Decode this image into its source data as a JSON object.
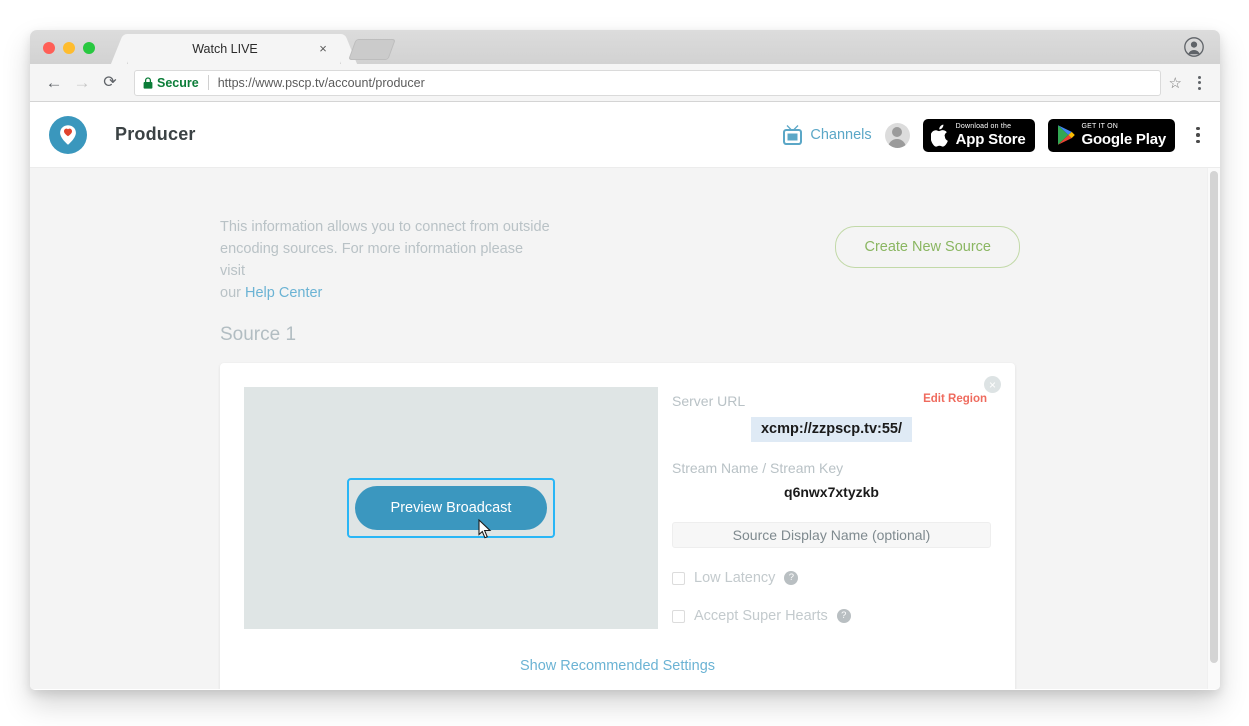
{
  "browser": {
    "tab": {
      "title": "Watch LIVE",
      "close_label": "×"
    },
    "new_tab_name": "new-tab",
    "nav": {
      "back": "←",
      "forward": "→",
      "reload": "⟳"
    },
    "omnibox": {
      "secure_label": "Secure",
      "url": "https://www.pscp.tv/account/producer",
      "star": "☆"
    }
  },
  "header": {
    "brand": "Producer",
    "channels_label": "Channels",
    "app_store": {
      "small": "Download on the",
      "big": "App Store"
    },
    "google_play": {
      "small": "GET IT ON",
      "big": "Google Play"
    }
  },
  "main": {
    "intro_line1": "This information allows you to connect from outside",
    "intro_line2": "encoding sources. For more information please visit",
    "intro_line3_prefix": "our ",
    "help_link": "Help Center",
    "create_button": "Create New Source",
    "source_title": "Source 1"
  },
  "card": {
    "close_label": "×",
    "preview_button": "Preview Broadcast",
    "server_url_label": "Server URL",
    "server_url_value": "xcmp://zzpscp.tv:55/",
    "edit_region": "Edit Region",
    "stream_name_label": "Stream Name / Stream Key",
    "stream_key_value": "q6nwx7xtyzkb",
    "display_name_placeholder": "Source Display Name (optional)",
    "low_latency_label": "Low Latency",
    "super_hearts_label": "Accept Super Hearts",
    "help_glyph": "?",
    "recommended_link": "Show Recommended Settings"
  },
  "colors": {
    "brand_blue": "#3a97bd",
    "link_blue": "#6bb3d4",
    "green_outline": "#c2d9a8",
    "green_text": "#8ab661",
    "red_accent": "#ef6b5e",
    "focus_ring": "#29b6f6",
    "selection": "#dfeaf5",
    "page_bg": "#f4f4f4"
  }
}
